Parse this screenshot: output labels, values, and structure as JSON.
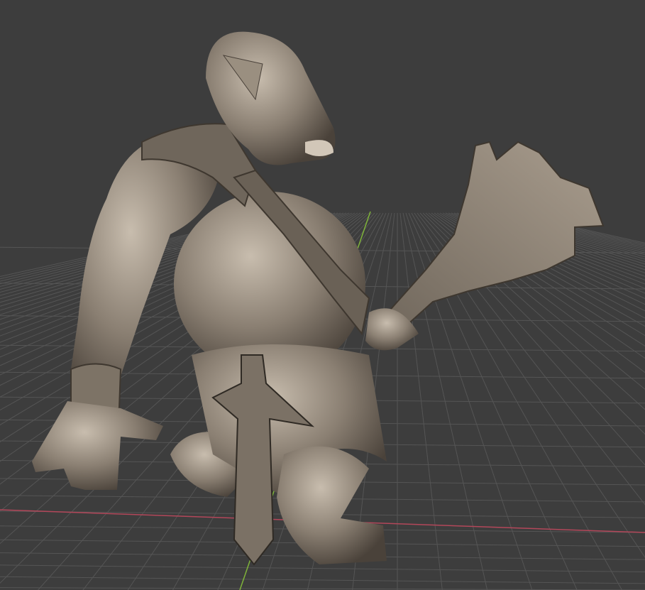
{
  "viewport": {
    "background_color": "#3d3d3d",
    "grid_color": "#555555",
    "x_axis_color": "#b3475a",
    "y_axis_color": "#7fb33a",
    "model_color": "#8a7f72",
    "model_shadow_color": "#4a423a",
    "model_highlight_color": "#c8bdae"
  }
}
